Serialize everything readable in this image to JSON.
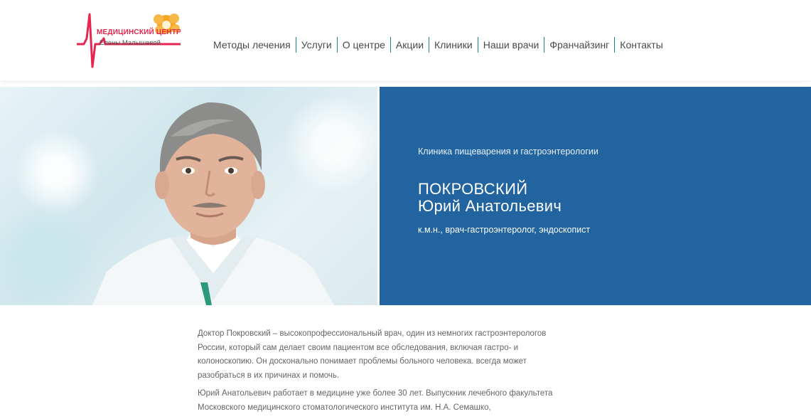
{
  "header": {
    "logo": {
      "title": "МЕДИЦИНСКИЙ ЦЕНТР",
      "subtitle": "Елены Малышевой",
      "brand_color": "#e8254f",
      "accent_color": "#f5a623"
    },
    "nav": [
      {
        "label": "Методы лечения"
      },
      {
        "label": "Услуги"
      },
      {
        "label": "О центре"
      },
      {
        "label": "Акции"
      },
      {
        "label": "Клиники"
      },
      {
        "label": "Наши врачи"
      },
      {
        "label": "Франчайзинг"
      },
      {
        "label": "Контакты"
      }
    ]
  },
  "hero": {
    "photo_icon": "doctor-portrait",
    "clinic": "Клиника пищеварения и гастроэнтерологии",
    "surname": "ПОКРОВСКИЙ",
    "name": "Юрий Анатольевич",
    "position": "к.м.н., врач-гастроэнтеролог, эндоскопист",
    "banner_color": "#2164a0"
  },
  "content": {
    "paragraphs": [
      "Доктор Покровский – высокопрофессиональный врач, один из немногих гастроэнтерологов России, который сам делает своим пациентом все обследования, включая гастро- и колоноскопию. Он досконально понимает проблемы больного человека. всегда может разобраться в их причинах и помочь.",
      "Юрий Анатольевич работает в медицине уже более 30 лет. Выпускник лечебного факультета Московского медицинского стоматологического института им. Н.А. Семашко,"
    ]
  }
}
